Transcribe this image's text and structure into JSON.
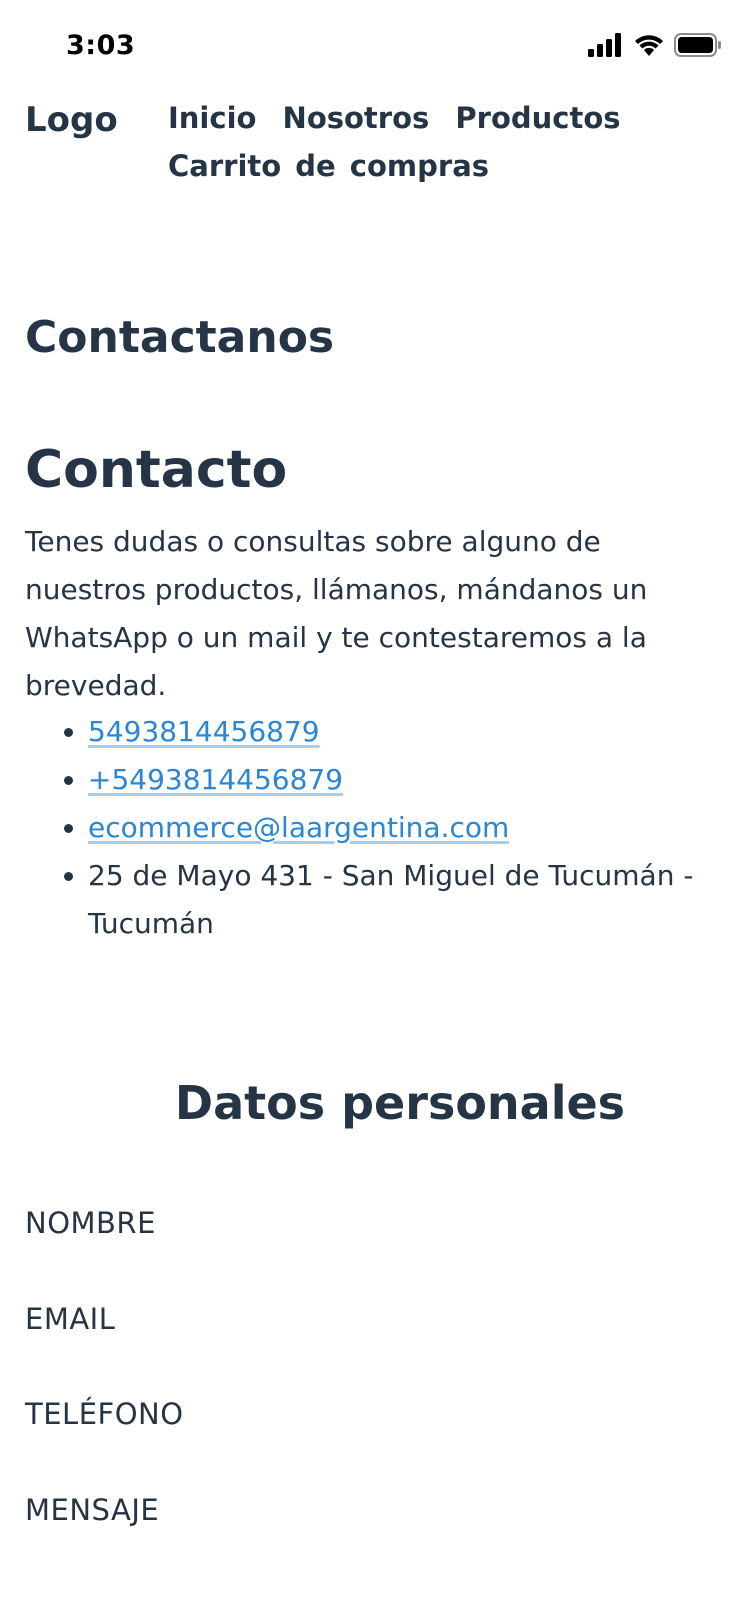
{
  "status_bar": {
    "time": "3:03"
  },
  "nav": {
    "logo": "Logo",
    "items": [
      "Inicio",
      "Nosotros",
      "Productos",
      "Carrito de compras"
    ]
  },
  "page": {
    "title": "Contactanos"
  },
  "contact": {
    "heading": "Contacto",
    "description": "Tenes dudas o consultas sobre alguno de nuestros productos, llámanos, mándanos un WhatsApp o un mail y te contestaremos a la brevedad.",
    "phone": "5493814456879",
    "whatsapp": "+5493814456879",
    "email": "ecommerce@laargentina.com",
    "address": "25 de Mayo 431 - San Miguel de Tucumán - Tucumán"
  },
  "form": {
    "heading": "Datos personales",
    "name_label": "NOMBRE",
    "email_label": "EMAIL",
    "phone_label": "TELÉFONO",
    "message_label": "MENSAJE"
  },
  "colors": {
    "text": "#263545",
    "link": "#2b86d4",
    "link_underline": "#a7cdee",
    "background": "#ffffff"
  }
}
